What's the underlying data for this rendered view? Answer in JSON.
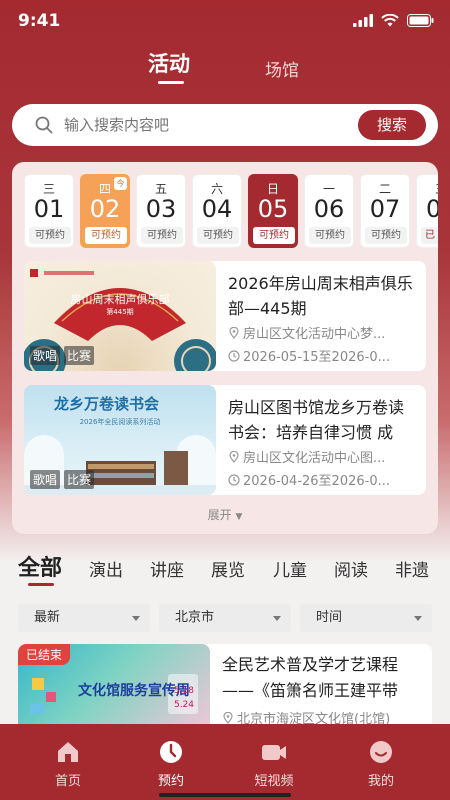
{
  "status_bar": {
    "time": "9:41"
  },
  "top_tabs": [
    "活动",
    "场馆"
  ],
  "search": {
    "placeholder": "输入搜索内容吧",
    "button": "搜索"
  },
  "dates": [
    {
      "weekday": "三",
      "day": "01",
      "status": "可预约"
    },
    {
      "weekday": "四",
      "day": "02",
      "status": "可预约",
      "badge": "今"
    },
    {
      "weekday": "五",
      "day": "03",
      "status": "可预约"
    },
    {
      "weekday": "六",
      "day": "04",
      "status": "可预约"
    },
    {
      "weekday": "日",
      "day": "05",
      "status": "可预约"
    },
    {
      "weekday": "一",
      "day": "06",
      "status": "可预约"
    },
    {
      "weekday": "二",
      "day": "07",
      "status": "可预约"
    },
    {
      "weekday": "三",
      "day": "0",
      "status": "已"
    }
  ],
  "featured_events": [
    {
      "title": "2026年房山周末相声俱乐部—445期",
      "tags": [
        "歌唱",
        "比赛"
      ],
      "location": "房山区文化活动中心梦...",
      "date": "2026-05-15至2026-0...",
      "thumb_text": "房山周末相声俱乐部",
      "thumb_sub": "第445期"
    },
    {
      "title": "房山区图书馆龙乡万卷读书会：培养自律习惯 成",
      "tags": [
        "歌唱",
        "比赛"
      ],
      "location": "房山区文化活动中心图...",
      "date": "2026-04-26至2026-0...",
      "thumb_text": "龙乡万卷读书会",
      "thumb_sub": "2026年全民阅读系列活动"
    }
  ],
  "expand_label": "展开",
  "categories": [
    "全部",
    "演出",
    "讲座",
    "展览",
    "儿童",
    "阅读",
    "非遗"
  ],
  "filters": [
    "最新",
    "北京市",
    "时间"
  ],
  "list_events": [
    {
      "status": "已结束",
      "title": "全民艺术普及学才艺课程——《笛箫名师王建平带",
      "location": "北京市海淀区文化馆(北馆)",
      "thumb_text": "文化馆服务宣传周",
      "thumb_dates": "5.18 5.24"
    }
  ],
  "bottom_nav": [
    "首页",
    "预约",
    "短视频",
    "我的"
  ],
  "colors": {
    "brand": "#a42a30",
    "today": "#f5a157",
    "ended": "#e0433e"
  }
}
